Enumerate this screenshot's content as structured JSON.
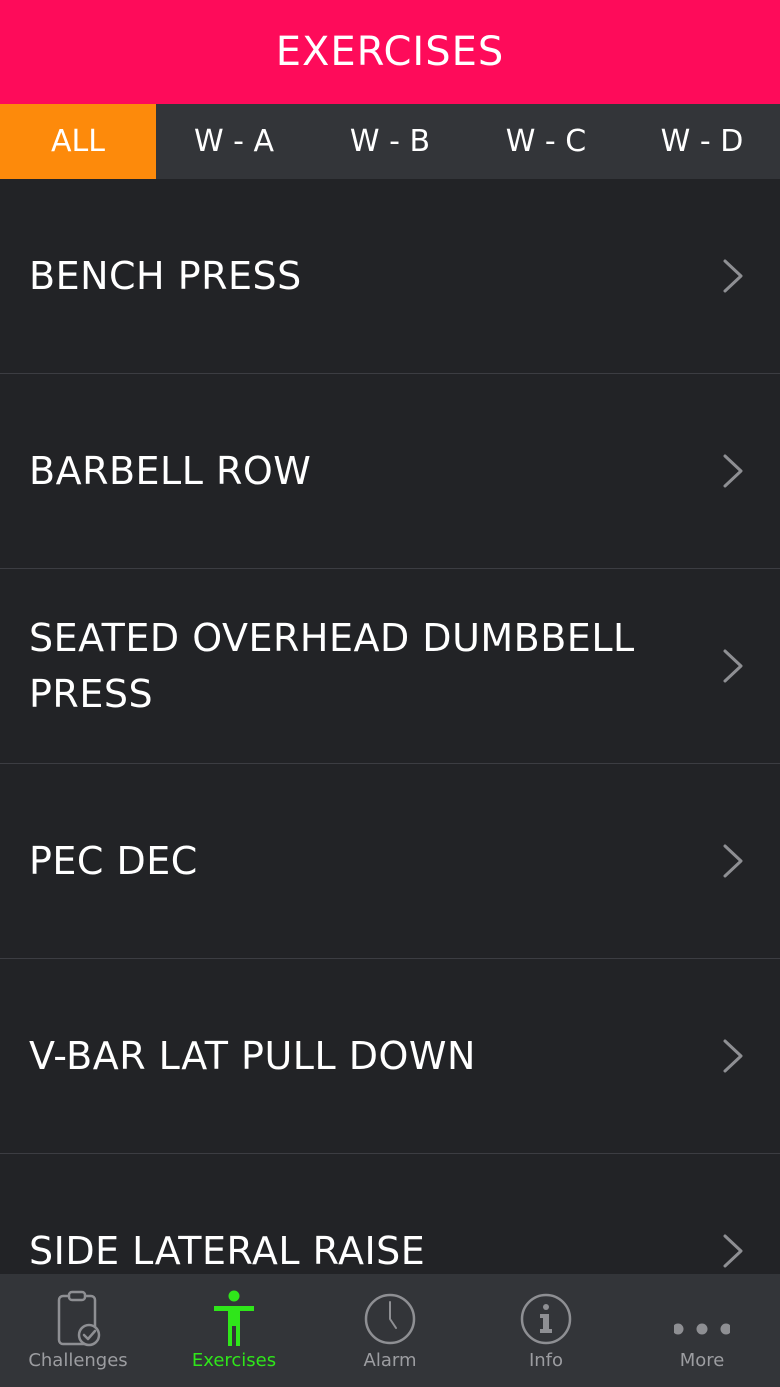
{
  "header": {
    "title": "EXERCISES"
  },
  "tabs": [
    {
      "label": "ALL",
      "active": true
    },
    {
      "label": "W - A",
      "active": false
    },
    {
      "label": "W - B",
      "active": false
    },
    {
      "label": "W - C",
      "active": false
    },
    {
      "label": "W - D",
      "active": false
    }
  ],
  "exercises": [
    {
      "label": "BENCH PRESS"
    },
    {
      "label": "BARBELL ROW"
    },
    {
      "label": "SEATED OVERHEAD DUMBBELL PRESS"
    },
    {
      "label": "PEC DEC"
    },
    {
      "label": "V-BAR LAT PULL DOWN"
    },
    {
      "label": "SIDE LATERAL RAISE"
    }
  ],
  "tabbar": [
    {
      "label": "Challenges",
      "icon": "clipboard-check-icon"
    },
    {
      "label": "Exercises",
      "icon": "person-icon",
      "active": true
    },
    {
      "label": "Alarm",
      "icon": "clock-icon"
    },
    {
      "label": "Info",
      "icon": "info-icon"
    },
    {
      "label": "More",
      "icon": "more-dots-icon"
    }
  ],
  "colors": {
    "header": "#fe0b5a",
    "tab_active": "#fd8a0b",
    "tabbar_active": "#2fe61a",
    "background": "#222326"
  }
}
